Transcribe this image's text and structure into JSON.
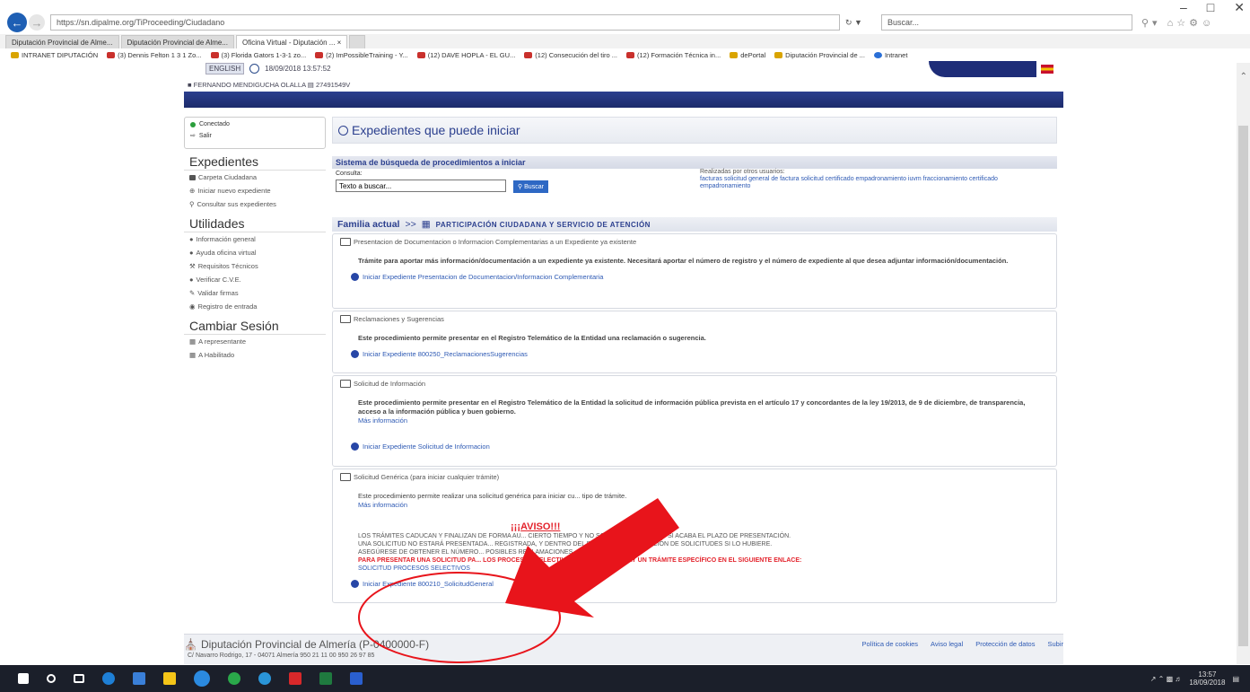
{
  "window": {
    "minimize": "–",
    "maximize": "□",
    "close": "✕"
  },
  "browser": {
    "url": "https://sn.dipalme.org/TiProceeding/Ciudadano",
    "search_placeholder": "Buscar...",
    "tabs": [
      {
        "label": "Diputación Provincial de Alme..."
      },
      {
        "label": "Diputación Provincial de Alme..."
      },
      {
        "label": "Oficina Virtual - Diputación ... ×"
      }
    ],
    "favorites": [
      {
        "label": "INTRANET DIPUTACIÓN"
      },
      {
        "label": "(3) Dennis Felton 1 3 1 Zo..."
      },
      {
        "label": "(3) Florida Gators 1-3-1 zo..."
      },
      {
        "label": "(2) ImPossibleTraining - Y..."
      },
      {
        "label": "(12) DAVE HOPLA - EL GU..."
      },
      {
        "label": "(12) Consecución del tiro ..."
      },
      {
        "label": "(12) Formación Técnica in..."
      },
      {
        "label": "dePortal"
      },
      {
        "label": "Diputación Provincial de ..."
      },
      {
        "label": "Intranet"
      }
    ]
  },
  "header": {
    "lang": "ENGLISH",
    "datetime": "18/09/2018 13:57:52",
    "user": "FERNANDO MENDIGUCHA OLALLA",
    "user_id": "27491549V"
  },
  "sidebar": {
    "status_connected": "Conectado",
    "logout": "Salir",
    "sections": [
      {
        "title": "Expedientes",
        "items": [
          "Carpeta Ciudadana",
          "Iniciar nuevo expediente",
          "Consultar sus expedientes"
        ]
      },
      {
        "title": "Utilidades",
        "items": [
          "Información general",
          "Ayuda oficina virtual",
          "Requisitos Técnicos",
          "Verificar C.V.E.",
          "Validar firmas",
          "Registro de entrada"
        ]
      },
      {
        "title": "Cambiar Sesión",
        "items": [
          "A representante",
          "A Habilitado"
        ]
      }
    ]
  },
  "main": {
    "title": "Expedientes que puede iniciar",
    "search": {
      "section_title": "Sistema de búsqueda de procedimientos a iniciar",
      "label": "Consulta:",
      "value": "Texto a buscar...",
      "button": "Buscar",
      "realizadas_label": "Realizadas por otros usuarios:",
      "realizadas_terms": "facturas solicitud general de factura solicitud certificado empadronamiento iuvm fraccionamiento certificado empadronamiento"
    },
    "familia": {
      "label": "Familia actual",
      "sep": ">>",
      "name": "PARTICIPACIÓN CIUDADANA Y SERVICIO DE ATENCIÓN"
    },
    "procedures": [
      {
        "title": "Presentacion de Documentacion o Informacion Complementarias a un Expediente ya existente",
        "description": "Trámite para aportar más información/documentación a un expediente ya existente. Necesitará aportar el número de registro y el número de expediente al que desea adjuntar información/documentación.",
        "link": "Iniciar Expediente Presentacion de Documentacion/Informacion Complementaria"
      },
      {
        "title": "Reclamaciones y Sugerencias",
        "description": "Este procedimiento permite presentar en el Registro Telemático de la Entidad una reclamación o sugerencia.",
        "link": "Iniciar Expediente 800250_ReclamacionesSugerencias"
      },
      {
        "title": "Solicitud de Información",
        "description": "Este procedimiento permite presentar en el Registro Telemático de la Entidad la solicitud de información pública prevista en el artículo 17 y concordantes de la ley 19/2013, de 9 de diciembre, de transparencia, acceso a la información pública y buen gobierno.",
        "more": "Más información",
        "link": "Iniciar Expediente Solicitud de Informacion"
      },
      {
        "title": "Solicitud Genérica (para iniciar cualquier trámite)",
        "description": "Este procedimiento permite realizar una solicitud genérica para iniciar cu... tipo de trámite.",
        "more": "Más información",
        "aviso_title": "¡¡¡AVISO!!!",
        "aviso_lines": [
          "LOS TRÁMITES CADUCAN Y FINALIZAN DE FORMA AU... CIERTO TIEMPO Y NO SON CONTINUADOS, O SI ACABA EL PLAZO DE PRESENTACIÓN.",
          "UNA SOLICITUD NO ESTARÁ PRESENTADA... REGISTRADA, Y DENTRO DEL PLAZO DE PRESENTACIÓN DE SOLICITUDES SI LO HUBIERE.",
          "ASEGÚRESE DE OBTENER EL NÚMERO... POSIBLES RECLAMACIONES."
        ],
        "aviso_red": "PARA PRESENTAR UNA SOLICITUD PA... LOS PROCESOS SELECTIVOS DE PERSONAL HAY UN TRÁMITE ESPECÍFICO EN EL SIGUIENTE ENLACE:",
        "aviso_link": "SOLICITUD PROCESOS SELECTIVOS",
        "link": "Iniciar Expediente 800210_SolicitudGeneral"
      }
    ]
  },
  "footer": {
    "title": "Diputación Provincial de Almería (P-0400000-F)",
    "address": "C/ Navarro Rodrigo, 17 - 04071 Almería   950 21 11 00   950 26 97 85",
    "links": [
      "Política de cookies",
      "Aviso legal",
      "Protección de datos",
      "Subir"
    ]
  },
  "taskbar": {
    "time": "13:57",
    "date": "18/09/2018"
  },
  "colors": {
    "brand_blue": "#2b3f8e",
    "link_blue": "#2e5ab4",
    "alert_red": "#e3232c",
    "annotation_red": "#e8141b"
  },
  "icons": [
    "back-arrow-icon",
    "forward-arrow-icon",
    "search-icon",
    "connected-icon",
    "logout-icon",
    "folder-icon",
    "info-icon",
    "wrench-icon",
    "clock-icon",
    "home-icon",
    "windows-start-icon"
  ]
}
